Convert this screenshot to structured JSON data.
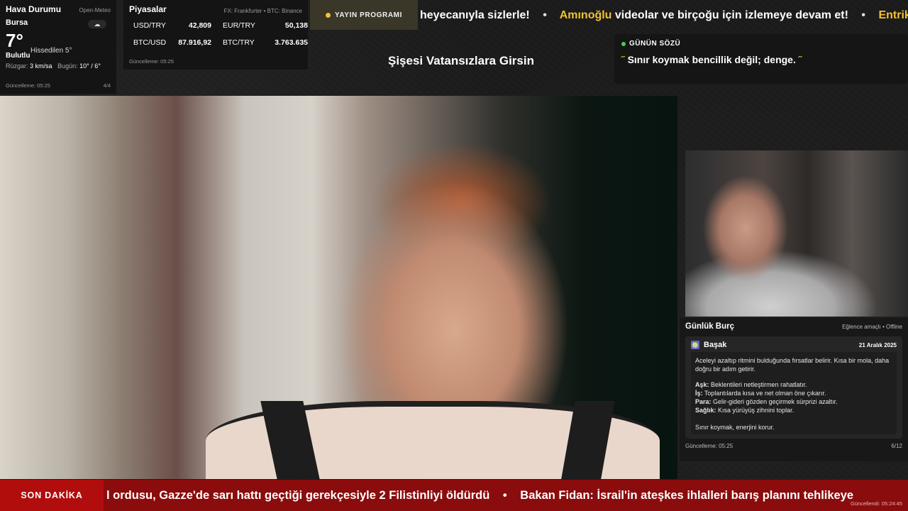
{
  "weather": {
    "title": "Hava Durumu",
    "source": "Open-Meteo",
    "city": "Bursa",
    "icon": "cloud-icon",
    "temp": "7°",
    "feels": "Hissedilen 5°",
    "condition": "Bulutlu",
    "wind_label": "Rüzgar:",
    "wind_value": "3 km/sa",
    "today_label": "Bugün:",
    "today_value": "10° / 6°",
    "updated": "Güncelleme: 05:25",
    "page": "4/4"
  },
  "markets": {
    "title": "Piyasalar",
    "source": "FX: Frankfurter • BTC: Binance",
    "items": [
      {
        "label": "USD/TRY",
        "value": "42,809"
      },
      {
        "label": "EUR/TRY",
        "value": "50,138"
      },
      {
        "label": "BTC/USD",
        "value": "87.916,92"
      },
      {
        "label": "BTC/TRY",
        "value": "3.763.635"
      }
    ],
    "updated": "Güncelleme: 05:25"
  },
  "broadcast": {
    "label": "YAYIN PROGRAMI",
    "dot_color": "#f2c230"
  },
  "top_ticker": {
    "part1": "heyecanıyla sizlerle!",
    "sep": "•",
    "highlight": "Amınoğlu",
    "part2": "videolar ve birçoğu için izlemeye devam et!",
    "part3": "Entrika",
    "highlight_color": "#f2c230"
  },
  "now_playing": {
    "title": "Şişesi Vatansızlara Girsin"
  },
  "quote": {
    "title": "GÜNÜN SÖZÜ",
    "open_mark": "˝",
    "text": "Sınır koymak bencillik değil; denge.",
    "close_mark": "˝"
  },
  "horoscope": {
    "title": "Günlük Burç",
    "subtitle": "Eğlence amaçlı • Offline",
    "sign": "Başak",
    "sign_icon": "virgo-icon",
    "date": "21 Aralık 2025",
    "intro": "Aceleyi azaltıp ritmini bulduğunda fırsatlar belirir. Kısa bir mola, daha doğru bir adım getirir.",
    "love_label": "Aşk:",
    "love": "Beklentileri netleştirmen rahatlatır.",
    "work_label": "İş:",
    "work": "Toplantılarda kısa ve net olman öne çıkarır.",
    "money_label": "Para:",
    "money": "Gelir-gideri gözden geçirmek sürprizi azaltır.",
    "health_label": "Sağlık:",
    "health": "Kısa yürüyüş zihnini toplar.",
    "closing": "Sınır koymak, enerjini korur.",
    "updated": "Güncelleme: 05:25",
    "page": "6/12"
  },
  "bottom_ticker": {
    "label": "SON DAKİKA",
    "item1": "l ordusu, Gazze'de sarı hattı geçtiği gerekçesiyle 2 Filistinliyi öldürdü",
    "sep": "•",
    "item2": "Bakan Fidan: İsrail'in ateşkes ihlalleri barış planını tehlikeye",
    "updated": "Güncellendi: 05:24:45"
  }
}
